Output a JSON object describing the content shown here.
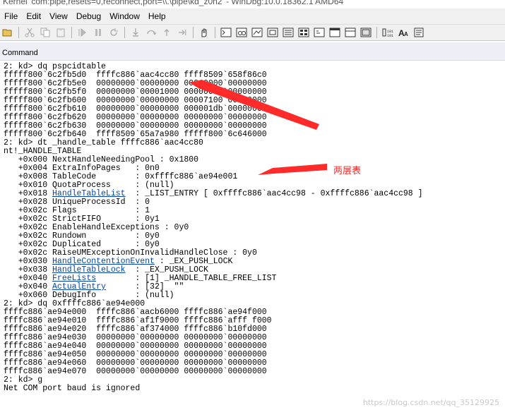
{
  "window": {
    "title": "Kernel 'com:pipe,resets=0,reconnect,port=\\\\.\\pipe\\kd_z0n2' - WinDbg:10.0.18362.1 AMD64"
  },
  "menu": {
    "items": [
      "File",
      "Edit",
      "View",
      "Debug",
      "Window",
      "Help"
    ]
  },
  "panel": {
    "title": "Command"
  },
  "console": {
    "lines": [
      "2: kd> dq pspcidtable",
      "fffff800`6c2fb5d0  ffffc886`aac4cc80 ffff8509`658f86c0",
      "fffff800`6c2fb5e0  00000000`00000000 00010000`00000000",
      "fffff800`6c2fb5f0  00000000`00001000 00000000`00000000",
      "fffff800`6c2fb600  00000000`00000000 00007100`00000000",
      "fffff800`6c2fb610  00000000`00000000 000001db`00000000",
      "fffff800`6c2fb620  00000000`00000000 00000000`00000000",
      "fffff800`6c2fb630  00000000`00000000 00000000`00000000",
      "fffff800`6c2fb640  ffff8509`65a7a980 fffff800`6c646000",
      "2: kd> dt _handle_table ffffc886`aac4cc80",
      "nt!_HANDLE_TABLE",
      "   +0x000 NextHandleNeedingPool : 0x1800",
      "   +0x004 ExtraInfoPages   : 0n0",
      "   +0x008 TableCode        : 0xffffc886`ae94e001",
      "   +0x010 QuotaProcess     : (null)",
      "   +0x018 {HandleTableList}  : _LIST_ENTRY [ 0xffffc886`aac4cc98 - 0xffffc886`aac4cc98 ]",
      "   +0x028 UniqueProcessId  : 0",
      "   +0x02c Flags            : 1",
      "   +0x02c StrictFIFO       : 0y1",
      "   +0x02c EnableHandleExceptions : 0y0",
      "   +0x02c Rundown          : 0y0",
      "   +0x02c Duplicated       : 0y0",
      "   +0x02c RaiseUMExceptionOnInvalidHandleClose : 0y0",
      "   +0x030 {HandleContentionEvent} : _EX_PUSH_LOCK",
      "   +0x038 {HandleTableLock}  : _EX_PUSH_LOCK",
      "   +0x040 {FreeLists}        : [1] _HANDLE_TABLE_FREE_LIST",
      "   +0x040 {ActualEntry}      : [32]  \"\"",
      "   +0x060 DebugInfo        : (null)",
      "2: kd> dq 0xffffc886`ae94e000",
      "ffffc886`ae94e000  ffffc886`aacb6000 ffffc886`ae94f000",
      "ffffc886`ae94e010  ffffc886`af1f9000 ffffc886`afff f000",
      "ffffc886`ae94e020  ffffc886`af374000 ffffc886`b10fd000",
      "ffffc886`ae94e030  00000000`00000000 00000000`00000000",
      "ffffc886`ae94e040  00000000`00000000 00000000`00000000",
      "ffffc886`ae94e050  00000000`00000000 00000000`00000000",
      "ffffc886`ae94e060  00000000`00000000 00000000`00000000",
      "ffffc886`ae94e070  00000000`00000000 00000000`00000000",
      "2: kd> g",
      "Net COM port baud is ignored"
    ]
  },
  "annotation": {
    "text": "两层表",
    "color": "#ff2a2a"
  },
  "watermark": {
    "text": "https://blog.csdn.net/qq_35129925"
  },
  "toolbar": {
    "icons": [
      "open-icon",
      "cut-icon",
      "copy-icon",
      "paste-icon",
      "go-icon",
      "break-icon",
      "restart-icon",
      "step-into-icon",
      "step-over-icon",
      "step-out-icon",
      "run-to-cursor-icon",
      "hand-icon",
      "command-window-icon",
      "watch-window-icon",
      "locals-window-icon",
      "registers-window-icon",
      "memory-window-icon",
      "call-stack-icon",
      "disassembly-icon",
      "scratch-pad-icon",
      "processes-threads-icon",
      "source-mode-icon",
      "hex-display-icon",
      "font-icon",
      "options-icon"
    ]
  }
}
